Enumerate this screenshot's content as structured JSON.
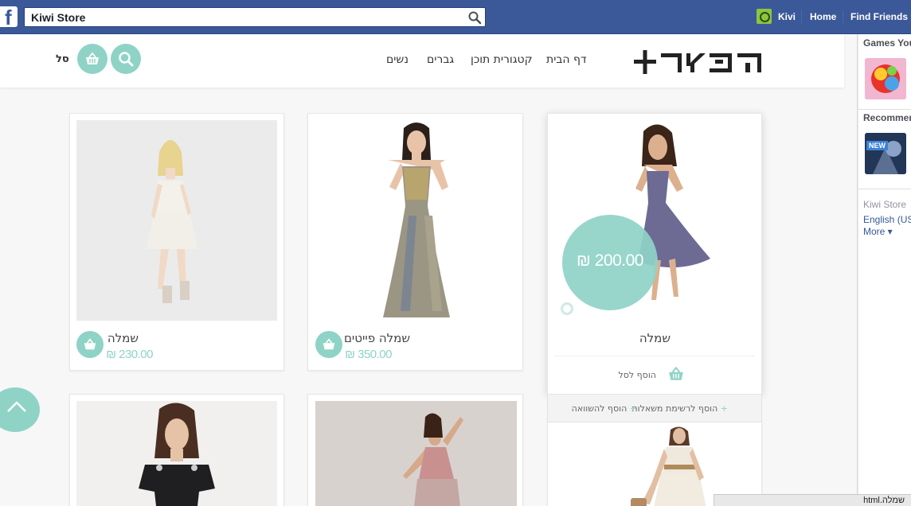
{
  "fb_bar": {
    "logo": "f",
    "search_value": "Kiwi Store",
    "user_name": "Kivi",
    "home_label": "Home",
    "find_friends_label": "Find Friends"
  },
  "site": {
    "nav": [
      "דף הבית",
      "קטגורית תוכן",
      "גברים",
      "נשים"
    ],
    "cart_label": "סל"
  },
  "products": [
    {
      "name": "שמלה",
      "price": "230.00 ₪"
    },
    {
      "name": "שמלה פייטים",
      "price": "350.00 ₪"
    },
    {
      "name": "שמלה",
      "price": "200.00 ₪",
      "add_to_cart": "הוסף לסל",
      "wishlist": "הוסף לרשימת משאלות",
      "compare": "הוסף להשוואה"
    }
  ],
  "sidebar": {
    "games_title": "Games You",
    "recommended_title": "Recommen",
    "new_badge": "NEW",
    "app_link": "Kiwi Store",
    "language": "English (US",
    "more": "More"
  },
  "status_bar": {
    "url": "שמלה.html"
  },
  "colors": {
    "fb_blue": "#3b5998",
    "accent_mint": "#8fd3c7"
  }
}
